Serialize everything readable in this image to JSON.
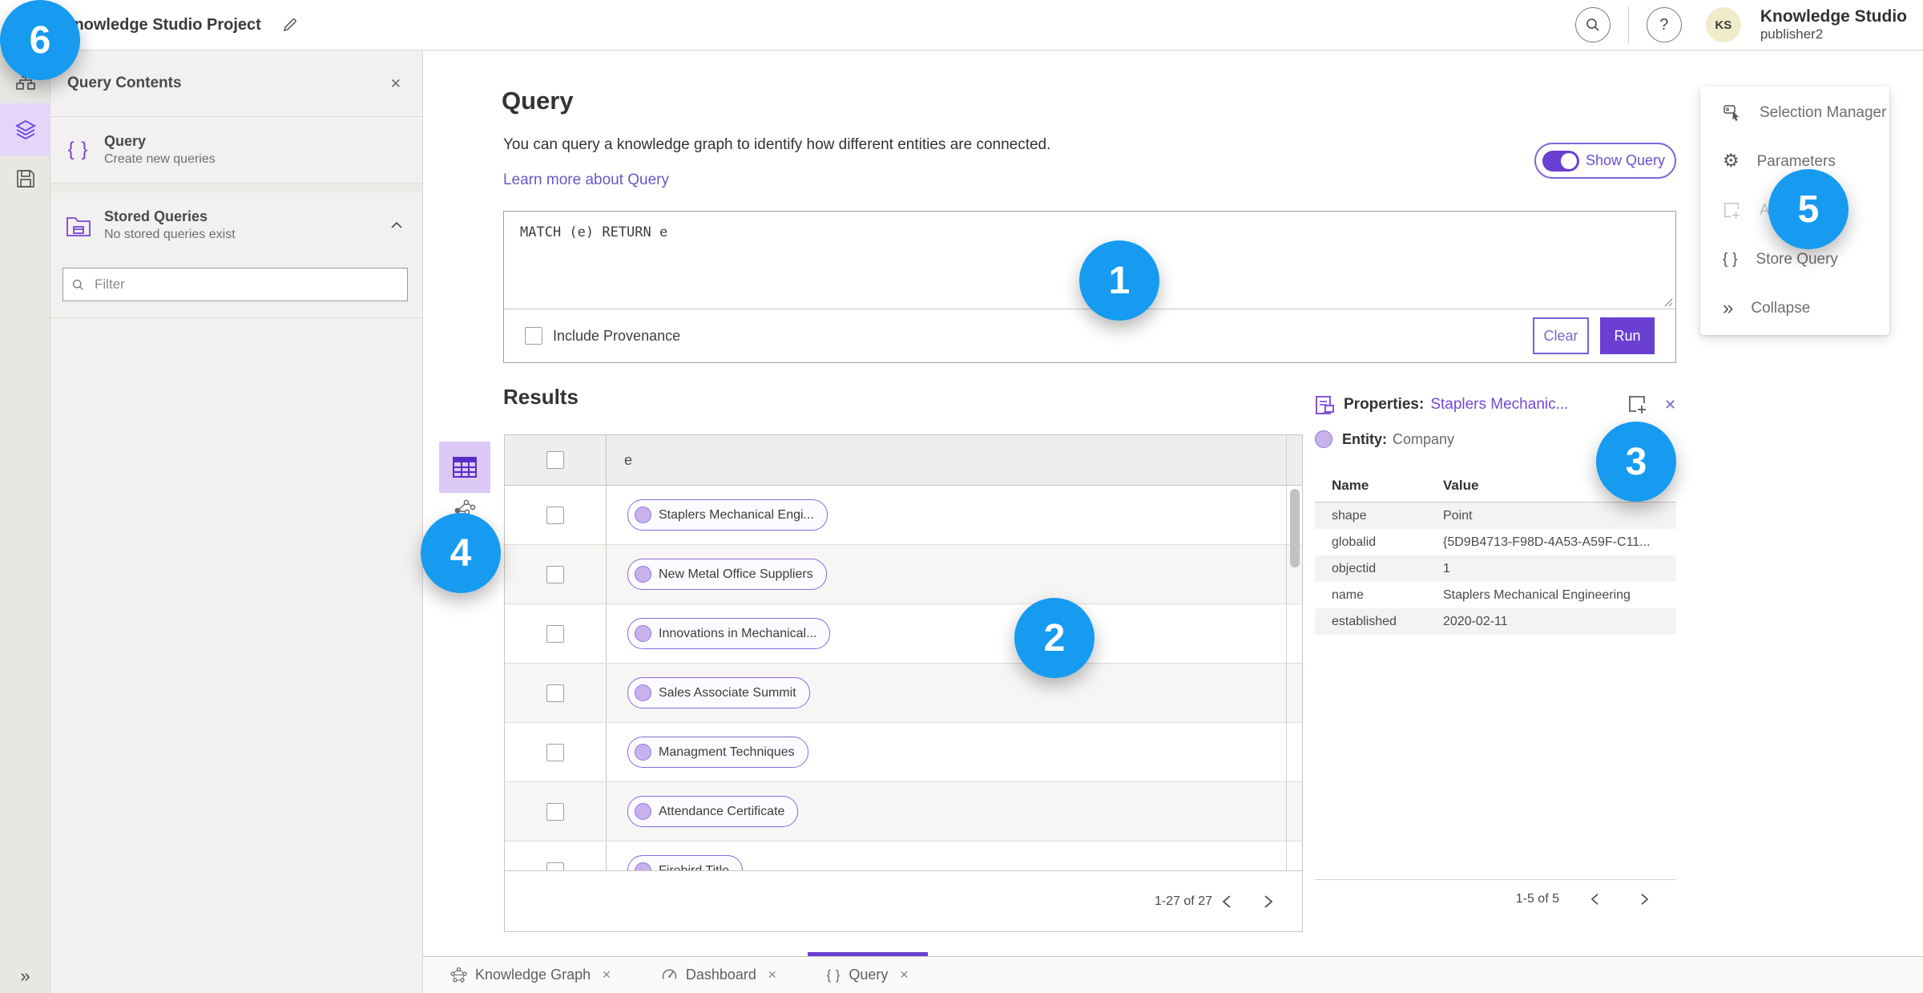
{
  "header": {
    "title": "Knowledge Studio Project",
    "account_name": "Knowledge Studio",
    "account_user": "publisher2",
    "avatar_initials": "KS",
    "help_glyph": "?"
  },
  "contents_panel": {
    "title": "Query Contents",
    "query_item": {
      "title": "Query",
      "subtitle": "Create new queries"
    },
    "stored_item": {
      "title": "Stored Queries",
      "subtitle": "No stored queries exist"
    },
    "filter_placeholder": "Filter"
  },
  "query_section": {
    "heading": "Query",
    "description": "You can query a knowledge graph to identify how different entities are connected.",
    "learn_more": "Learn more about Query",
    "show_query_label": "Show Query",
    "query_text": "MATCH (e) RETURN e",
    "include_provenance_label": "Include Provenance",
    "clear_label": "Clear",
    "run_label": "Run"
  },
  "results": {
    "heading": "Results",
    "column_header": "e",
    "rows": [
      "Staplers Mechanical Engi...",
      "New Metal Office Suppliers",
      "Innovations in Mechanical...",
      "Sales Associate Summit",
      "Managment Techniques",
      "Attendance Certificate",
      "Firebird Title"
    ],
    "pagination": "1-27 of 27"
  },
  "properties": {
    "heading": "Properties:",
    "entity_link": "Staplers Mechanic...",
    "entity_label": "Entity:",
    "entity_type": "Company",
    "col_name": "Name",
    "col_value": "Value",
    "rows": [
      {
        "name": "shape",
        "value": "Point"
      },
      {
        "name": "globalid",
        "value": "{5D9B4713-F98D-4A53-A59F-C11..."
      },
      {
        "name": "objectid",
        "value": "1"
      },
      {
        "name": "name",
        "value": "Staplers Mechanical Engineering"
      },
      {
        "name": "established",
        "value": "2020-02-11"
      }
    ],
    "pagination": "1-5 of 5"
  },
  "tools_menu": {
    "items": [
      {
        "label": "Selection Manager",
        "disabled": false
      },
      {
        "label": "Parameters",
        "disabled": false
      },
      {
        "label": "Add To Map",
        "disabled": true
      },
      {
        "label": "Store Query",
        "disabled": false
      },
      {
        "label": "Collapse",
        "disabled": false
      }
    ]
  },
  "tabs": [
    {
      "label": "Knowledge Graph",
      "active": false
    },
    {
      "label": "Dashboard",
      "active": false
    },
    {
      "label": "Query",
      "active": true
    }
  ],
  "badges": [
    "1",
    "2",
    "3",
    "4",
    "5",
    "6"
  ],
  "colors": {
    "accent_purple": "#6a3fd2",
    "link_purple": "#6a58c9",
    "badge_blue": "#169bf0",
    "pill_fill": "#c7b2ee",
    "pill_border": "#8b6bd8"
  }
}
